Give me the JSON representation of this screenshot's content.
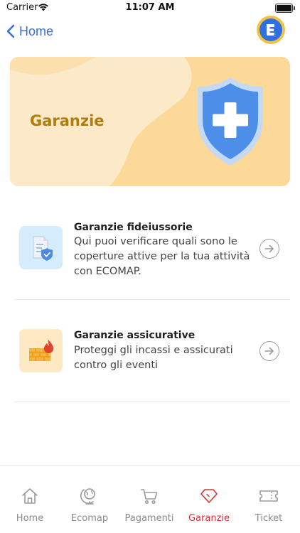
{
  "status_bar": {
    "carrier": "Carrier",
    "time": "11:07 AM"
  },
  "nav": {
    "back_label": "Home"
  },
  "hero": {
    "title": "Garanzie"
  },
  "items": [
    {
      "title": "Garanzie fideiussorie",
      "description": "Qui puoi verificare quali sono le coperture attive per la tua attività con ECOMAP.",
      "icon": "document-shield-icon",
      "icon_bg": "#d4ecfb"
    },
    {
      "title": "Garanzie assicurative",
      "description": "Proteggi gli incassi e assicurati contro gli eventi",
      "icon": "firewall-icon",
      "icon_bg": "#fde9c4"
    }
  ],
  "tabs": [
    {
      "label": "Home",
      "icon": "house-icon",
      "active": false
    },
    {
      "label": "Ecomap",
      "icon": "globe-icon",
      "active": false
    },
    {
      "label": "Pagamenti",
      "icon": "cart-icon",
      "active": false
    },
    {
      "label": "Garanzie",
      "icon": "diamond-icon",
      "active": true
    },
    {
      "label": "Ticket",
      "icon": "ticket-icon",
      "active": false
    }
  ],
  "colors": {
    "accent": "#3a6fd8",
    "active_tab": "#d13232",
    "hero_bg": "#fcd899",
    "hero_title": "#b07d0b"
  }
}
